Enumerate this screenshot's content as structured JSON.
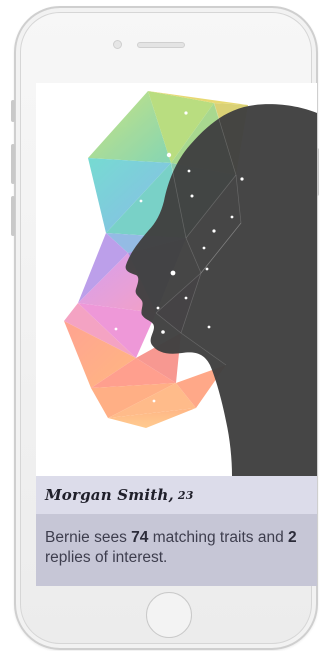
{
  "profile": {
    "name": "Morgan Smith,",
    "age": "23",
    "info_prefix": "Bernie sees ",
    "traits_count": "74",
    "info_middle": " matching traits and ",
    "replies_count": "2",
    "info_suffix": " replies of interest."
  },
  "colors": {
    "silhouette": "#404040",
    "name_bar": "#dcdcea",
    "info_panel": "#c6c6d6"
  },
  "icons": [
    "camera-icon",
    "speaker-icon",
    "home-button-icon"
  ]
}
